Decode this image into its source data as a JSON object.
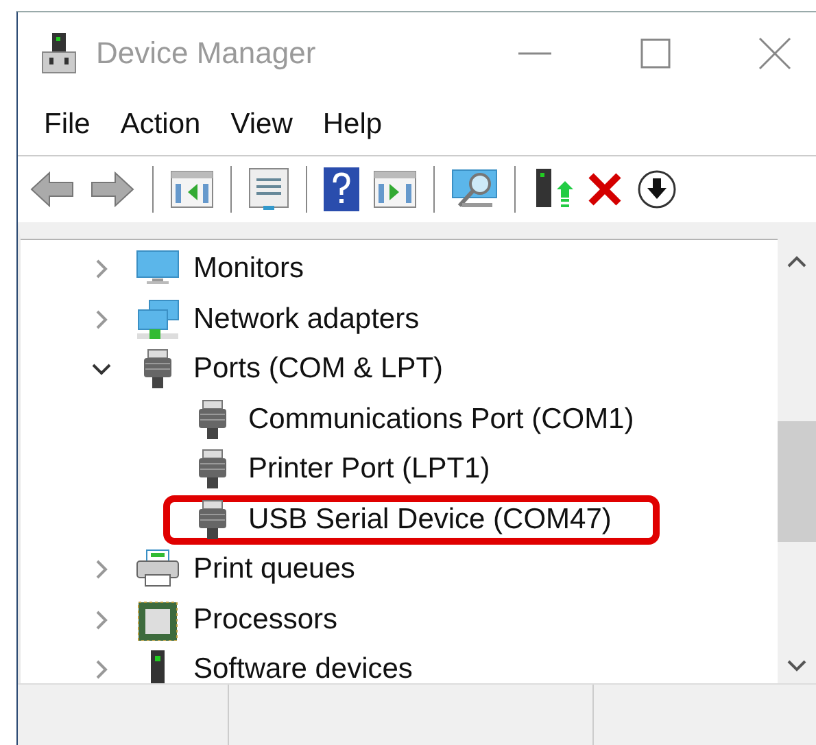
{
  "window": {
    "title": "Device Manager"
  },
  "menu": [
    "File",
    "Action",
    "View",
    "Help"
  ],
  "tree": {
    "items": [
      {
        "label": "Monitors",
        "kind": "monitor",
        "expanded": false
      },
      {
        "label": "Network adapters",
        "kind": "network",
        "expanded": false
      },
      {
        "label": "Ports (COM & LPT)",
        "kind": "port",
        "expanded": true,
        "children": [
          {
            "label": "Communications Port (COM1)",
            "kind": "port",
            "highlighted": false
          },
          {
            "label": "Printer Port (LPT1)",
            "kind": "port",
            "highlighted": false
          },
          {
            "label": "USB Serial Device (COM47)",
            "kind": "port",
            "highlighted": true
          }
        ]
      },
      {
        "label": "Print queues",
        "kind": "printer",
        "expanded": false
      },
      {
        "label": "Processors",
        "kind": "processor",
        "expanded": false
      },
      {
        "label": "Software devices",
        "kind": "software",
        "expanded": false
      }
    ]
  }
}
